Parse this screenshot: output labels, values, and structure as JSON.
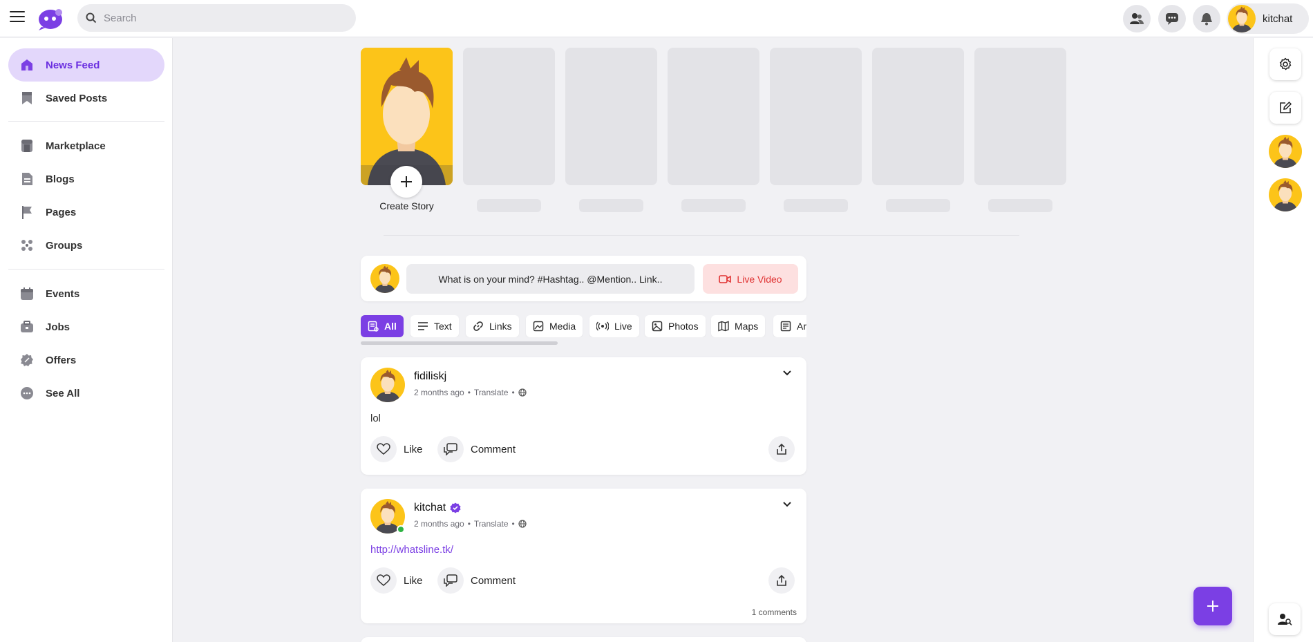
{
  "header": {
    "search_placeholder": "Search",
    "username": "kitchat",
    "icons": [
      "menu-icon",
      "app-logo",
      "search-icon",
      "friends-icon",
      "messages-icon",
      "notifications-icon"
    ]
  },
  "sidebar": {
    "items": [
      {
        "label": "News Feed",
        "icon": "home-icon",
        "active": true
      },
      {
        "label": "Saved Posts",
        "icon": "bookmark-icon"
      },
      {
        "label": "Marketplace",
        "icon": "store-icon"
      },
      {
        "label": "Blogs",
        "icon": "document-icon"
      },
      {
        "label": "Pages",
        "icon": "flag-icon"
      },
      {
        "label": "Groups",
        "icon": "group-icon"
      },
      {
        "label": "Events",
        "icon": "calendar-icon"
      },
      {
        "label": "Jobs",
        "icon": "briefcase-icon"
      },
      {
        "label": "Offers",
        "icon": "discount-icon"
      },
      {
        "label": "See All",
        "icon": "more-icon"
      }
    ]
  },
  "stories": {
    "create_label": "Create Story"
  },
  "composer": {
    "prompt": "What is on your mind? #Hashtag.. @Mention.. Link..",
    "live_label": "Live Video"
  },
  "filters": {
    "tabs": [
      {
        "label": "All",
        "icon": "posts-icon",
        "active": true
      },
      {
        "label": "Text",
        "icon": "text-icon"
      },
      {
        "label": "Links",
        "icon": "link-icon"
      },
      {
        "label": "Media",
        "icon": "media-icon"
      },
      {
        "label": "Live",
        "icon": "broadcast-icon"
      },
      {
        "label": "Photos",
        "icon": "image-icon"
      },
      {
        "label": "Maps",
        "icon": "map-icon"
      },
      {
        "label": "Ar",
        "icon": "article-icon"
      }
    ]
  },
  "posts": [
    {
      "author": "fidiliskj",
      "time": "2 months ago",
      "translate": "Translate",
      "privacy_icon": "globe-icon",
      "body": "lol",
      "like_label": "Like",
      "comment_label": "Comment"
    },
    {
      "author": "kitchat",
      "verified": true,
      "online": true,
      "time": "2 months ago",
      "translate": "Translate",
      "privacy_icon": "globe-icon",
      "body": "http://whatsline.tk/",
      "like_label": "Like",
      "comment_label": "Comment",
      "comments_count": "1 comments"
    }
  ],
  "colors": {
    "accent": "#7b3fe4",
    "active_bg": "#e3d7fb",
    "live_bg": "#fde0e0",
    "live_text": "#e03131",
    "online": "#2fb344",
    "avatar_bg": "#fcc419"
  }
}
